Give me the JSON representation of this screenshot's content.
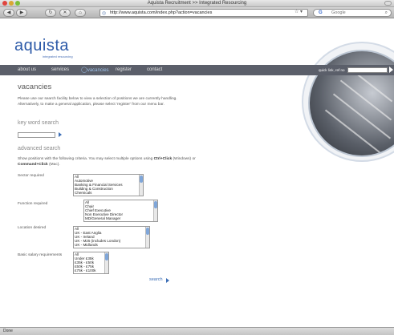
{
  "window": {
    "title": "Aquista Recruitment >> Integrated Resourcing"
  },
  "browser": {
    "url": "http://www.aquista.com/index.php?action=vacancies",
    "search_engine": "Google",
    "status": "Done"
  },
  "site": {
    "logo": "aquista",
    "tagline": "integrated resourcing",
    "nav": [
      "about us",
      "services",
      "vacancies",
      "register",
      "contact"
    ],
    "quick_link_label": "quick link, ref no"
  },
  "main": {
    "heading": "vacancies",
    "intro": "Please use our search facility below to view a selection of positions we are currently handling. Alternatively, to make a general application, please select 'register' from our menu bar.",
    "keyword_heading": "key word search",
    "advanced_heading": "advanced search",
    "advanced_text_1": "Show positions with the following criteria. You may select multiple options using ",
    "ctrl_click": "Ctrl+Click",
    "advanced_text_2": " (Windows) or ",
    "cmd_click": "Command+Click",
    "advanced_text_3": " (Mac).",
    "search_link": "search"
  },
  "filters": {
    "sector": {
      "label": "Sector required",
      "options": [
        "All",
        "Automotive",
        "Banking & Financial Services",
        "Building & Construction",
        "Chemicals"
      ]
    },
    "function": {
      "label": "Function required",
      "options": [
        "All",
        "Chair",
        "Chief Executive",
        "Non Executive Director",
        "MD/General Manager"
      ]
    },
    "location": {
      "label": "Location desired",
      "options": [
        "All",
        "UK - East Anglia",
        "UK - Ireland",
        "UK - M25 (includes London)",
        "UK - Midlands"
      ]
    },
    "salary": {
      "label": "Basic salary requirements",
      "options": [
        "All",
        "Under £35k",
        "£35k - £50k",
        "£50k - £75k",
        "£75k - £100k"
      ]
    }
  },
  "colors": {
    "brand": "#2d5aa8",
    "nav_bg": "#5b5f6a",
    "link": "#3d6fb6"
  }
}
